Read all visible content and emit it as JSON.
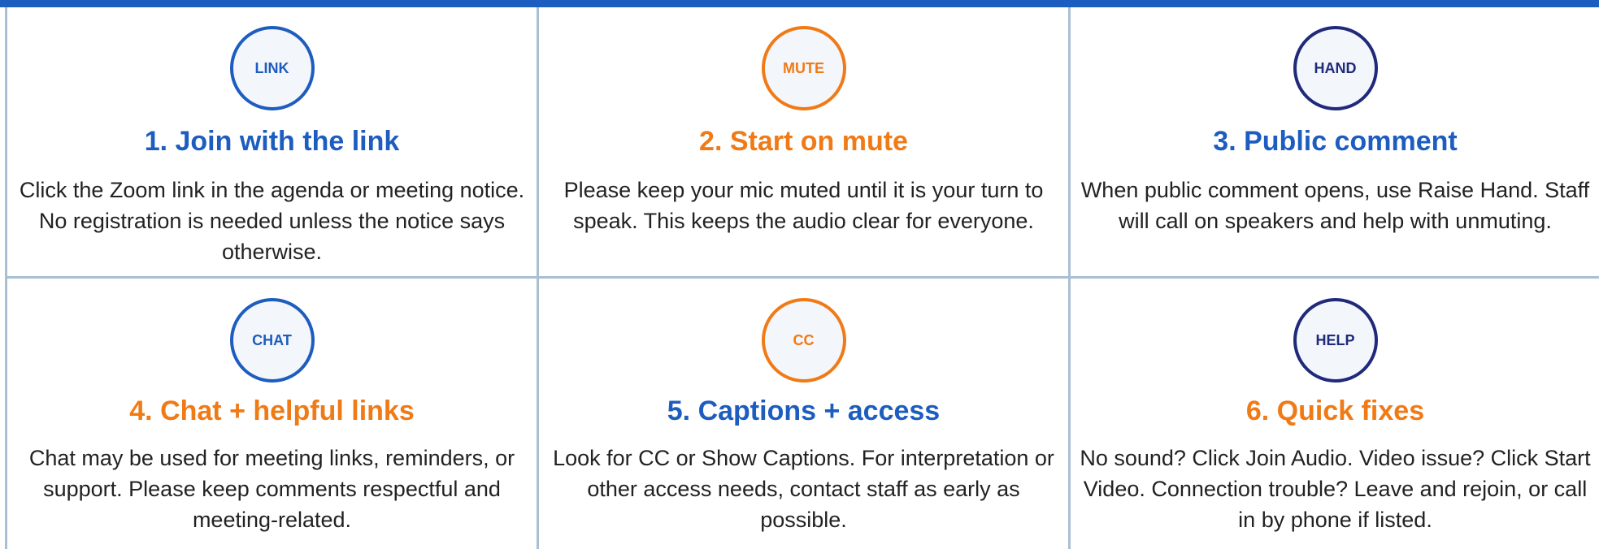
{
  "colors": {
    "top_bar": "#1d5dbf",
    "blue": "#1d5dbf",
    "orange": "#f07a15",
    "navy": "#1f2a7a",
    "grid_lines": "#a9bfd3",
    "badge_fill": "#f3f6fb"
  },
  "cards": [
    {
      "badge": "LINK",
      "title": "1. Join with the link",
      "text": "Click the Zoom link in the agenda or meeting notice. No registration is needed unless the notice says otherwise."
    },
    {
      "badge": "MUTE",
      "title": "2. Start on mute",
      "text": "Please keep your mic muted until it is your turn to speak. This keeps the audio clear for everyone."
    },
    {
      "badge": "HAND",
      "title": "3. Public comment",
      "text": "When public comment opens, use Raise Hand. Staff will call on speakers and help with unmuting."
    },
    {
      "badge": "CHAT",
      "title": "4. Chat + helpful links",
      "text": "Chat may be used for meeting links, reminders, or support. Please keep comments respectful and meeting-related."
    },
    {
      "badge": "CC",
      "title": "5. Captions + access",
      "text": "Look for CC or Show Captions. For interpretation or other access needs, contact staff as early as possible."
    },
    {
      "badge": "HELP",
      "title": "6. Quick fixes",
      "text": "No sound? Click Join Audio. Video issue? Click Start Video. Connection trouble? Leave and rejoin, or call in by phone if listed."
    }
  ]
}
